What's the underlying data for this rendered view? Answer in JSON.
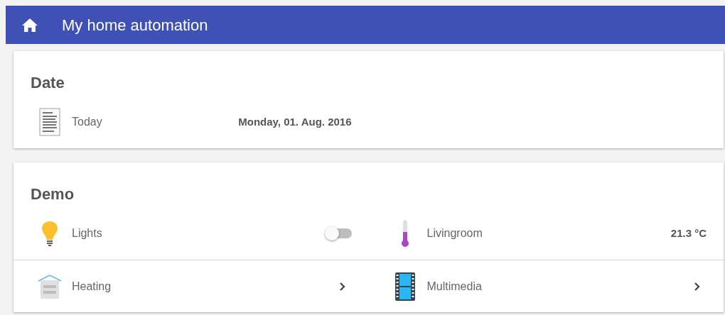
{
  "header": {
    "title": "My home automation"
  },
  "cards": [
    {
      "title": "Date",
      "items": [
        {
          "kind": "value",
          "label": "Today",
          "value": "Monday, 01. Aug. 2016"
        }
      ]
    },
    {
      "title": "Demo",
      "items": [
        {
          "kind": "switch",
          "label": "Lights",
          "on": false
        },
        {
          "kind": "value",
          "label": "Livingroom",
          "value": "21.3 °C"
        },
        {
          "kind": "link",
          "label": "Heating"
        },
        {
          "kind": "link",
          "label": "Multimedia"
        }
      ]
    }
  ]
}
